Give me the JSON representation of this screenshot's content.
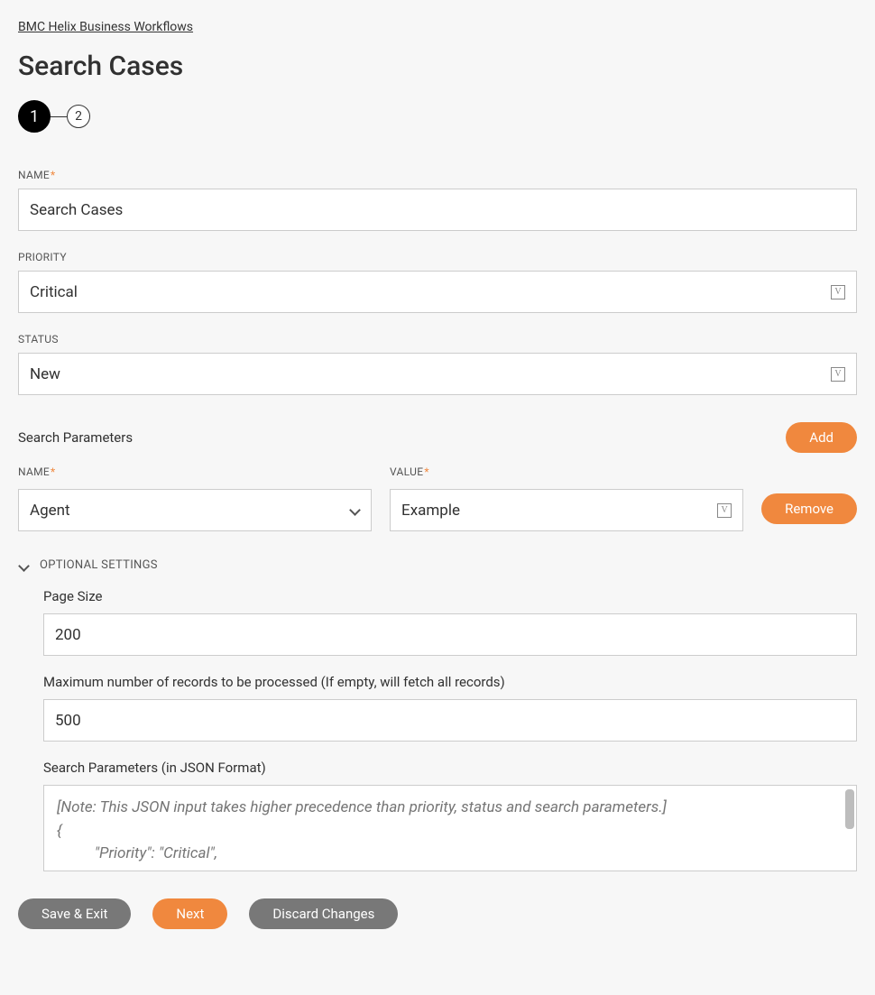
{
  "breadcrumb": "BMC Helix Business Workflows",
  "page_title": "Search Cases",
  "stepper": {
    "steps": [
      "1",
      "2"
    ],
    "active": 0
  },
  "fields": {
    "name": {
      "label": "NAME",
      "required": true,
      "value": "Search Cases"
    },
    "priority": {
      "label": "PRIORITY",
      "required": false,
      "value": "Critical"
    },
    "status": {
      "label": "STATUS",
      "required": false,
      "value": "New"
    }
  },
  "search_params": {
    "header": "Search Parameters",
    "add_label": "Add",
    "remove_label": "Remove",
    "row": {
      "name_label": "NAME",
      "name_value": "Agent",
      "value_label": "VALUE",
      "value_value": "Example"
    }
  },
  "optional": {
    "header": "OPTIONAL SETTINGS",
    "page_size": {
      "label": "Page Size",
      "value": "200"
    },
    "max_records": {
      "label": "Maximum number of records to be processed (If empty, will fetch all records)",
      "value": "500"
    },
    "json_params": {
      "label": "Search Parameters (in JSON Format)",
      "placeholder": "[Note: This JSON input takes higher precedence than priority, status and search parameters.]\n{\n          \"Priority\": \"Critical\","
    }
  },
  "footer": {
    "save_exit": "Save & Exit",
    "next": "Next",
    "discard": "Discard Changes"
  }
}
